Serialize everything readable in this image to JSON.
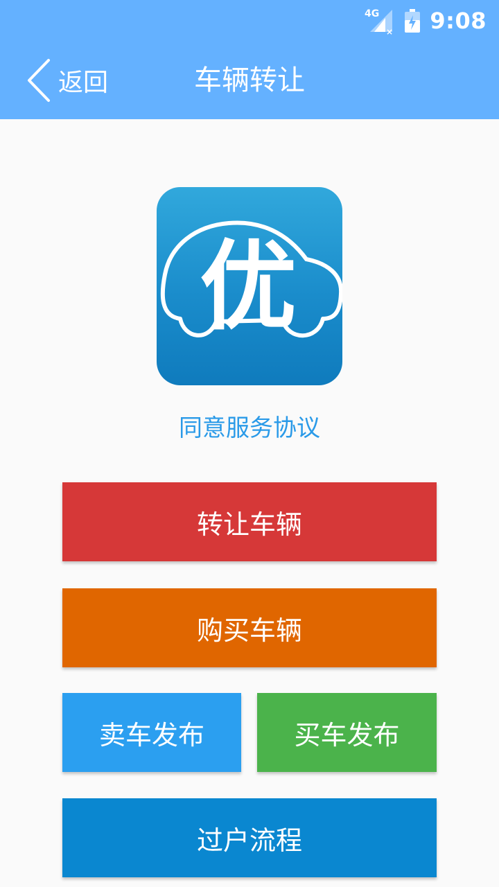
{
  "status_bar": {
    "network_label": "4G",
    "time": "9:08"
  },
  "toolbar": {
    "back_label": "返回",
    "title": "车辆转让"
  },
  "logo": {
    "glyph": "优",
    "icon": "car-logo-icon"
  },
  "agreement_link": "同意服务协议",
  "buttons": {
    "transfer_vehicle": "转让车辆",
    "buy_vehicle": "购买车辆",
    "sell_publish": "卖车发布",
    "buy_publish": "买车发布",
    "transfer_process": "过户流程"
  },
  "colors": {
    "header": "#64b1ff",
    "transfer_vehicle": "#d63838",
    "buy_vehicle": "#e06600",
    "sell_publish": "#2b9ff0",
    "buy_publish": "#4bb34b",
    "transfer_process": "#0a87d0",
    "link": "#2a9ae8"
  }
}
